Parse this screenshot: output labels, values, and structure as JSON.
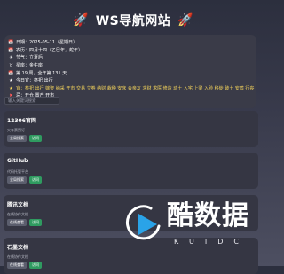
{
  "header": {
    "title": "WS导航网站",
    "left_icon": "rocket-icon",
    "right_icon": "rocket-icon"
  },
  "info": {
    "lines": [
      {
        "icon": "calendar-icon",
        "text": "日期：2025-05-11（星期日）"
      },
      {
        "icon": "calendar-icon",
        "text": "农历：四月十四（乙巳年，蛇年）"
      },
      {
        "icon": "weather-icon",
        "text": "节气：立夏后"
      },
      {
        "icon": "zodiac-icon",
        "text": "星座：金牛座"
      },
      {
        "icon": "calendar-icon",
        "text": "第 19 周，全年第 131 天"
      },
      {
        "icon": "star-icon",
        "text": "今日宜：祭祀 出行"
      },
      {
        "icon": "star-icon",
        "text": "宜：祭祀 出行 嫁娶 纳采 开市 交易 立券 纳财 栽种 安床 会亲友 求财 求医 修造 动土 入宅 上梁 入殓 移徙 破土 安葬 行丧"
      },
      {
        "icon": "cross-icon",
        "text": "忌：开仓 置产 开市"
      }
    ]
  },
  "search": {
    "placeholder": "输入关键词搜索"
  },
  "sites": [
    {
      "title": "12306官网",
      "desc": "火车票预订",
      "btn1": "全局搜索",
      "btn2": "访问"
    },
    {
      "title": "GitHub",
      "desc": "代码托管平台",
      "btn1": "全局搜索",
      "btn2": "访问"
    },
    {
      "title": "腾讯文档",
      "desc": "在线协作文档",
      "btn1": "在线查看",
      "btn2": "访问"
    },
    {
      "title": "石墨文档",
      "desc": "在线协作文档",
      "btn1": "在线查看",
      "btn2": "访问"
    }
  ],
  "watermark": {
    "cn": "酷数据",
    "en": "KUIDC"
  }
}
